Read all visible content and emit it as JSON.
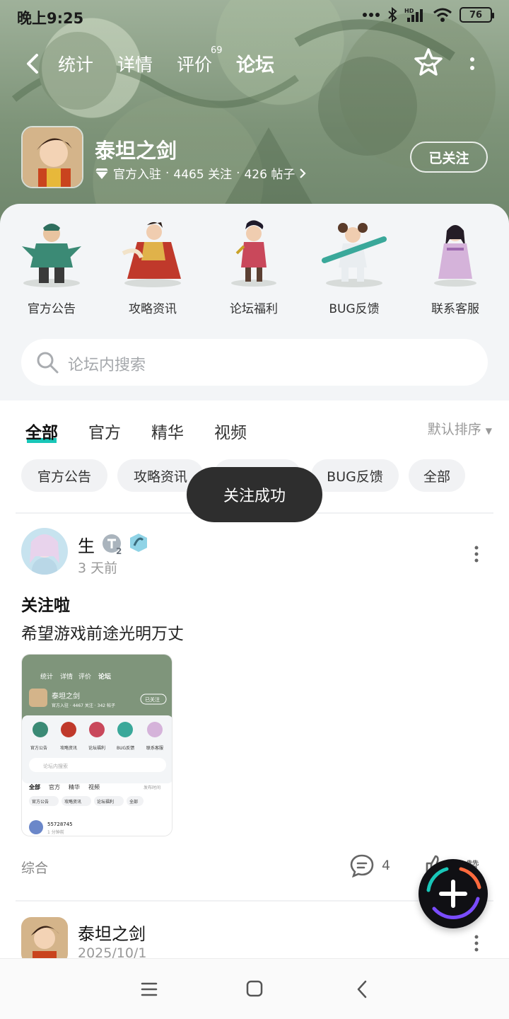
{
  "status_bar": {
    "time": "晚上9:25",
    "battery": "76",
    "network": "HD"
  },
  "nav": {
    "tabs": [
      {
        "label": "统计"
      },
      {
        "label": "详情"
      },
      {
        "label": "评价",
        "badge": "69"
      },
      {
        "label": "论坛"
      }
    ],
    "active_tab": "论坛",
    "accent_color": "#19c6b8"
  },
  "game": {
    "name": "泰坦之剑",
    "official": "官方入驻",
    "followers": "4465 关注",
    "posts": "426 帖子",
    "follow_button": "已关注"
  },
  "categories": [
    {
      "label": "官方公告"
    },
    {
      "label": "攻略资讯"
    },
    {
      "label": "论坛福利"
    },
    {
      "label": "BUG反馈"
    },
    {
      "label": "联系客服"
    }
  ],
  "search": {
    "placeholder": "论坛内搜索"
  },
  "feed_tabs": [
    {
      "label": "全部"
    },
    {
      "label": "官方"
    },
    {
      "label": "精华"
    },
    {
      "label": "视频"
    }
  ],
  "sort_label": "默认排序",
  "chips": [
    {
      "label": "官方公告"
    },
    {
      "label": "攻略资讯"
    },
    {
      "label": "论坛福利"
    },
    {
      "label": "BUG反馈"
    },
    {
      "label": "全部"
    }
  ],
  "toast": "关注成功",
  "post": {
    "user": "生",
    "level": "2",
    "time": "3 天前",
    "title": "关注啦",
    "body": "希望游戏前途光明万丈",
    "tag": "综合",
    "comments": "4",
    "like_label": "点赞"
  },
  "thumbnail": {
    "tabs": [
      "统计",
      "详情",
      "评价",
      "论坛"
    ],
    "game_name": "泰坦之剑",
    "meta": "官方入驻 · 4467 关注 · 342 帖子",
    "follow": "已关注",
    "categories": [
      "官方公告",
      "攻略资讯",
      "论坛福利",
      "BUG反馈",
      "联系客服"
    ],
    "search": "论坛内搜索",
    "feed_tabs": [
      "全部",
      "官方",
      "精华",
      "视频"
    ],
    "sort": "发布时间",
    "chips": [
      "官方公告",
      "攻略资讯",
      "论坛福利",
      "全部"
    ],
    "user": "55728745",
    "time": "1 分钟前"
  },
  "post2": {
    "user": "泰坦之剑",
    "time": "2025/10/1"
  }
}
